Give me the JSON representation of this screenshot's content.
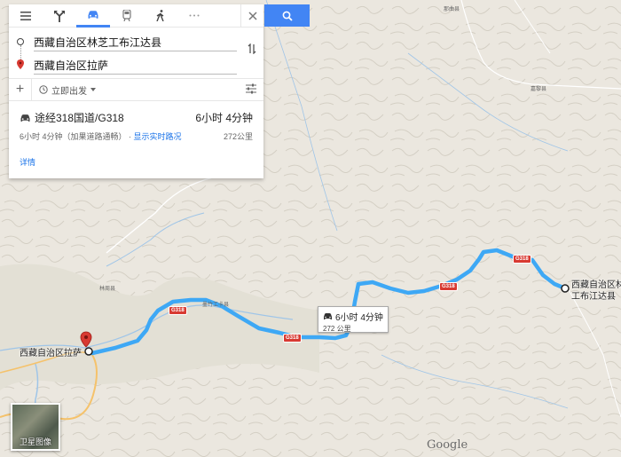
{
  "directions": {
    "modes": [
      "best-route-icon",
      "car-icon",
      "transit-icon",
      "walk-icon",
      "more-icon"
    ],
    "origin": "西藏自治区林芝工布江达县",
    "destination": "西藏自治区拉萨",
    "depart_label": "立即出发",
    "route_summary": "途经318国道/G318",
    "route_duration": "6小时 4分钟",
    "route_sub": "6小时 4分钟（加果道路通畅）",
    "traffic_link": "显示实时路况",
    "route_distance": "272公里",
    "details_link": "详情"
  },
  "map": {
    "callout_duration": "6小时 4分钟",
    "callout_distance": "272 公里",
    "start_label": "西藏自治区拉萨",
    "end_label_1": "西藏自治区林",
    "end_label_2": "工布江达县",
    "highway": "G318",
    "town_1": "林周县",
    "town_2": "墨竹工卡县",
    "town_3": "嘉黎县",
    "town_4": "那曲县",
    "satellite_label": "卫星图像",
    "brand": "Google",
    "route_color": "#3ea8f5",
    "highway_color": "#d83a32"
  }
}
